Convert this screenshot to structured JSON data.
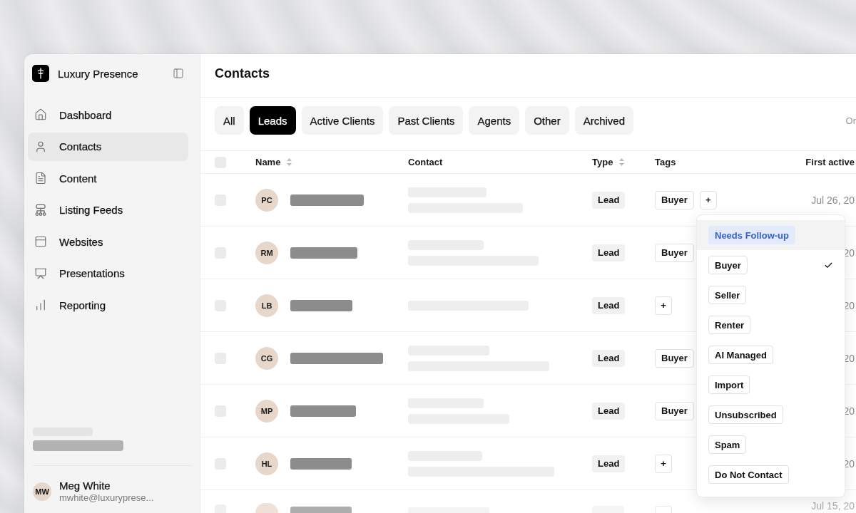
{
  "sidebar": {
    "brand": "Luxury Presence",
    "nav": [
      {
        "label": "Dashboard",
        "selected": false
      },
      {
        "label": "Contacts",
        "selected": true
      },
      {
        "label": "Content",
        "selected": false
      },
      {
        "label": "Listing Feeds",
        "selected": false
      },
      {
        "label": "Websites",
        "selected": false
      },
      {
        "label": "Presentations",
        "selected": false
      },
      {
        "label": "Reporting",
        "selected": false
      }
    ],
    "user": {
      "initials": "MW",
      "name": "Meg White",
      "email": "mwhite@luxuryprese..."
    }
  },
  "page": {
    "title": "Contacts"
  },
  "tabs": [
    {
      "label": "All",
      "selected": false
    },
    {
      "label": "Leads",
      "selected": true
    },
    {
      "label": "Active Clients",
      "selected": false
    },
    {
      "label": "Past Clients",
      "selected": false
    },
    {
      "label": "Agents",
      "selected": false
    },
    {
      "label": "Other",
      "selected": false
    },
    {
      "label": "Archived",
      "selected": false
    }
  ],
  "right_label": "Or",
  "table": {
    "select_all_checked": false,
    "columns": [
      {
        "label": "Name",
        "sortable": true
      },
      {
        "label": "Contact",
        "sortable": false
      },
      {
        "label": "Type",
        "sortable": true
      },
      {
        "label": "Tags",
        "sortable": false
      },
      {
        "label": "First active",
        "sortable": false
      }
    ],
    "rows": [
      {
        "kind": "full",
        "checked": false,
        "initials": "PC",
        "type": "Lead",
        "tags": [
          "Buyer"
        ],
        "add_label": "+",
        "first_active": "Jul 26, 20"
      },
      {
        "kind": "full",
        "checked": false,
        "initials": "RM",
        "type": "Lead",
        "tags": [
          "Buyer"
        ],
        "first_active": "20"
      },
      {
        "kind": "full",
        "checked": false,
        "initials": "LB",
        "type": "Lead",
        "add_label": "+",
        "first_active": "20"
      },
      {
        "kind": "full",
        "checked": false,
        "initials": "CG",
        "type": "Lead",
        "tags": [
          "Buyer"
        ],
        "first_active": "20"
      },
      {
        "kind": "full",
        "checked": false,
        "initials": "MP",
        "type": "Lead",
        "tags": [
          "Buyer"
        ],
        "first_active": "20"
      },
      {
        "kind": "full",
        "checked": false,
        "initials": "HL",
        "type": "Lead",
        "add_label": "+",
        "first_active": "20"
      },
      {
        "kind": "cut",
        "checked": false,
        "first_active": "Jul 15, 20"
      }
    ]
  },
  "tag_menu": {
    "items": [
      {
        "label": "Needs Follow-up",
        "kind": "filled",
        "highlighted": true,
        "checked": false
      },
      {
        "label": "Buyer",
        "kind": "outlined",
        "highlighted": false,
        "checked": true
      },
      {
        "label": "Seller",
        "kind": "outlined",
        "highlighted": false,
        "checked": false
      },
      {
        "label": "Renter",
        "kind": "outlined",
        "highlighted": false,
        "checked": false
      },
      {
        "label": "AI Managed",
        "kind": "outlined",
        "highlighted": false,
        "checked": false
      },
      {
        "label": "Import",
        "kind": "outlined",
        "highlighted": false,
        "checked": false
      },
      {
        "label": "Unsubscribed",
        "kind": "outlined",
        "highlighted": false,
        "checked": false
      },
      {
        "label": "Spam",
        "kind": "outlined",
        "highlighted": false,
        "checked": false
      },
      {
        "label": "Do Not Contact",
        "kind": "outlined",
        "highlighted": false,
        "checked": false
      }
    ]
  }
}
